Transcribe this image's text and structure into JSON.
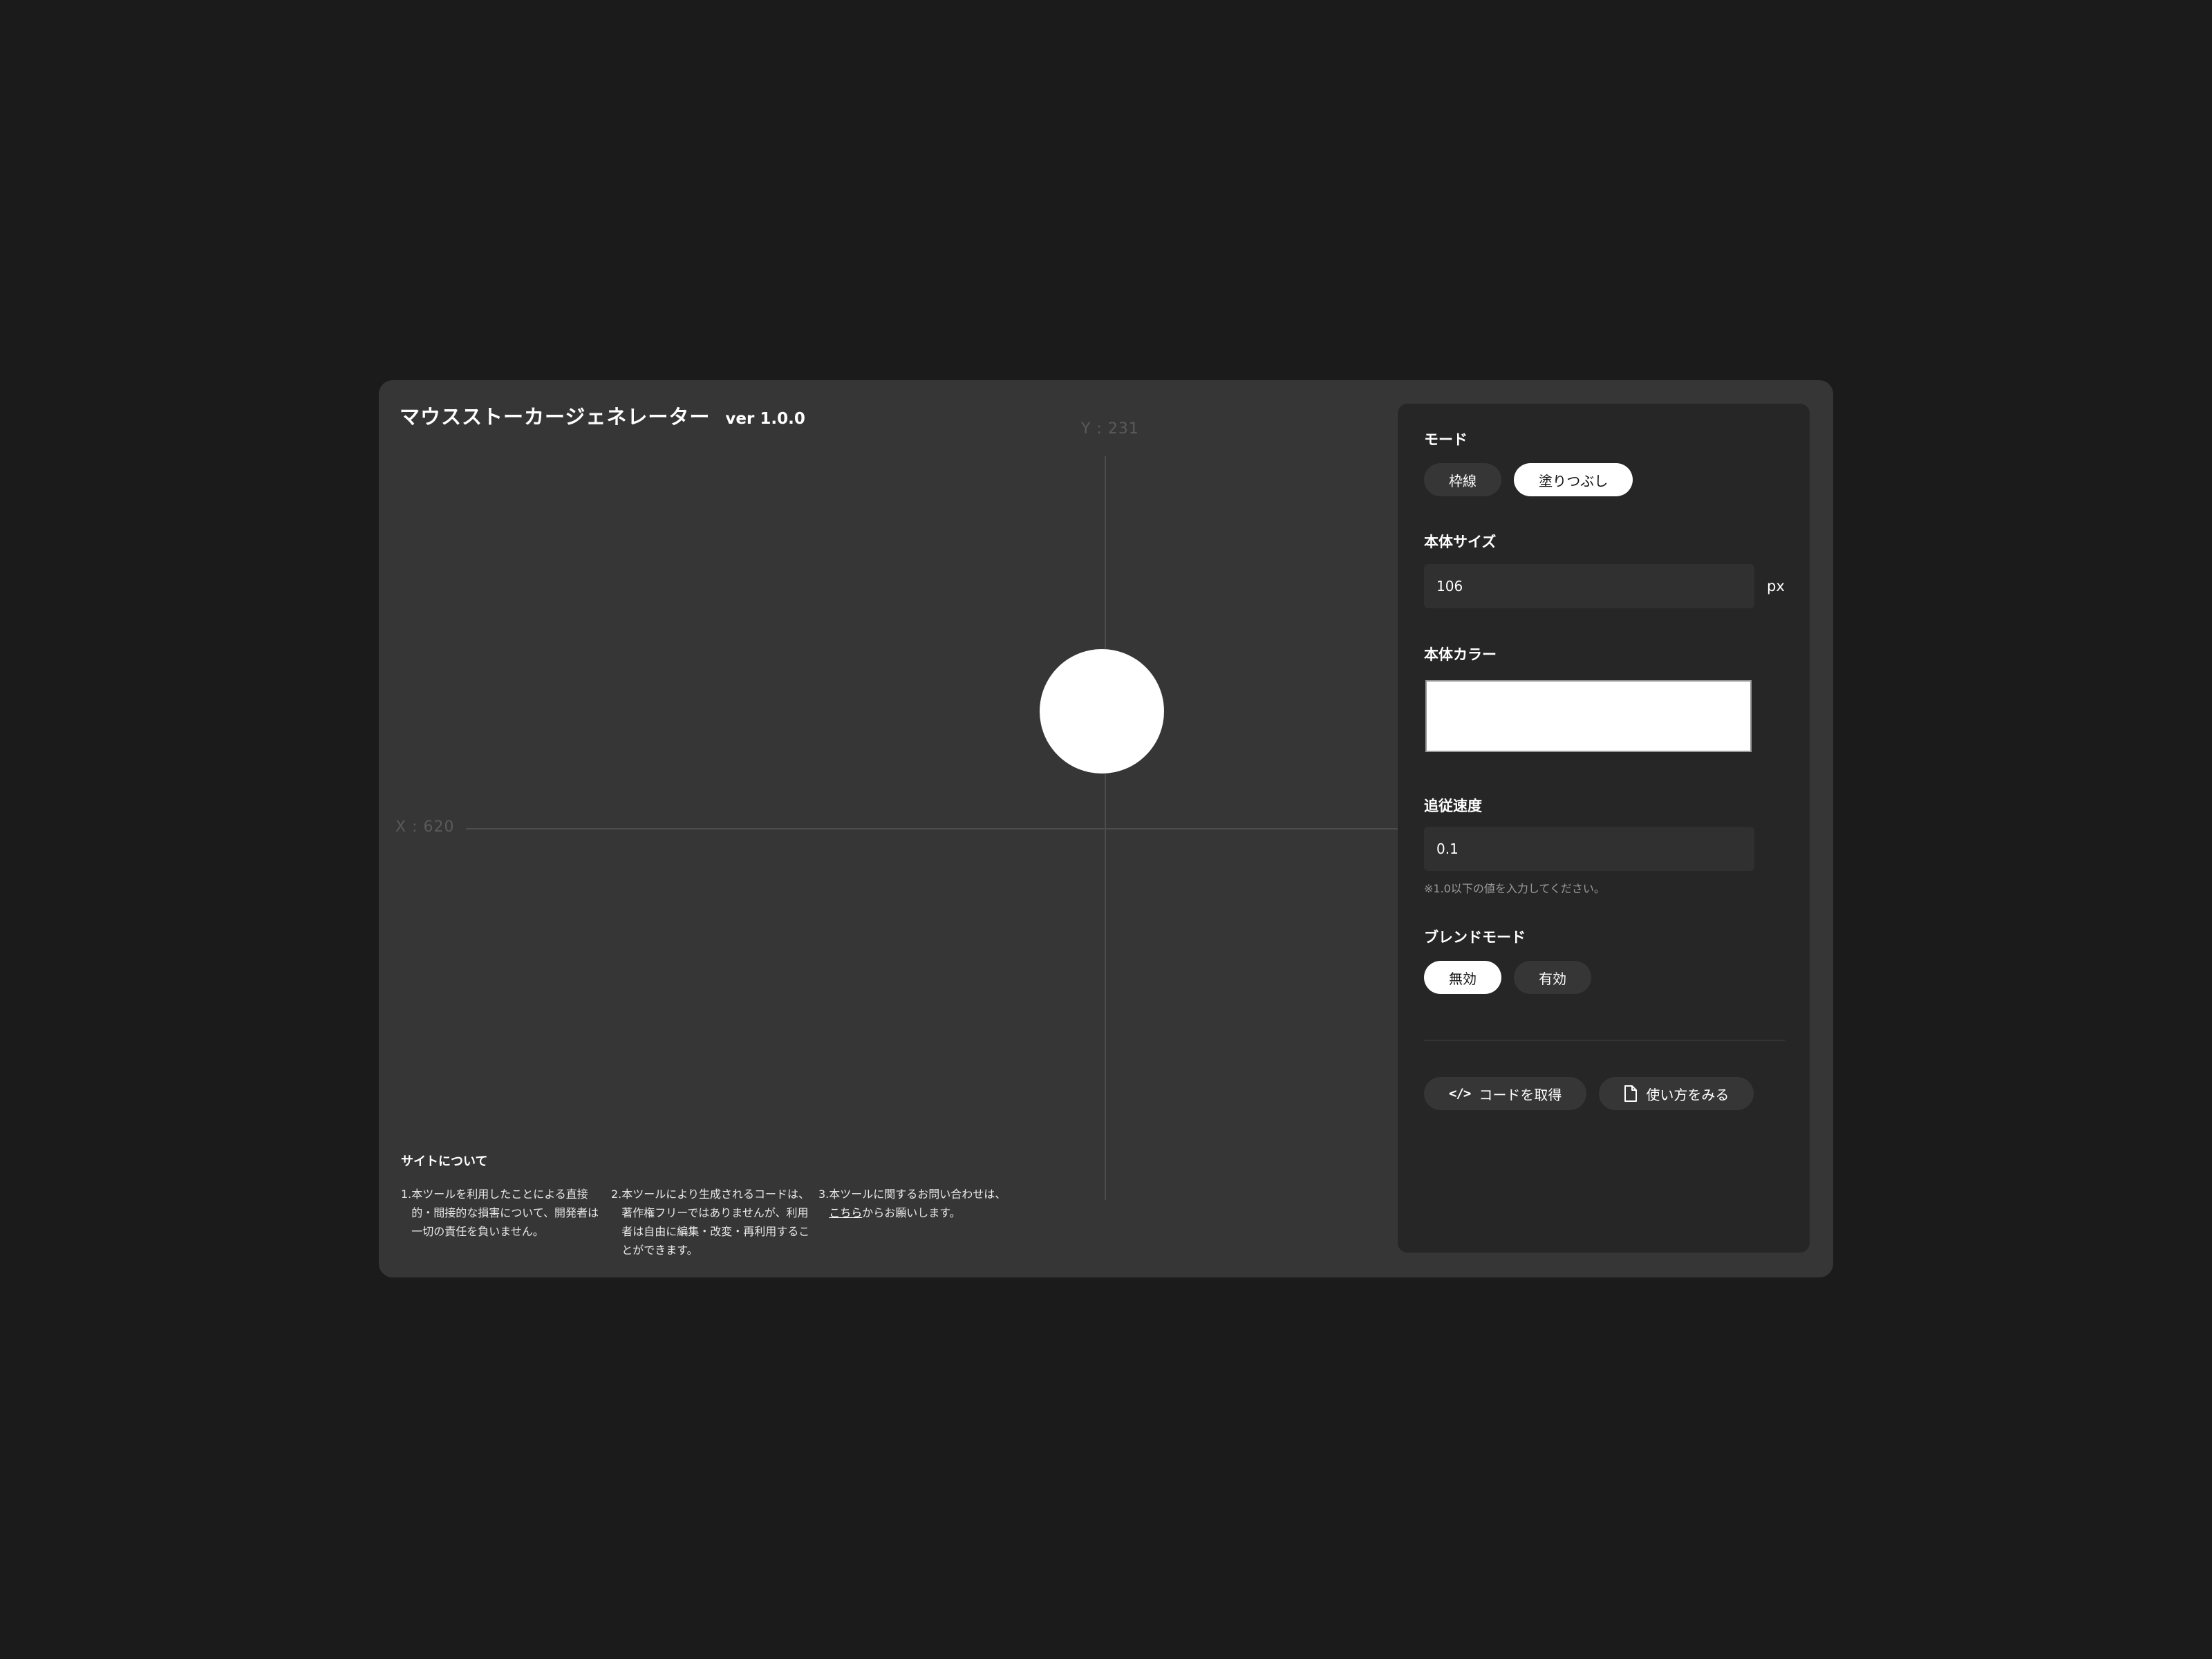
{
  "app": {
    "title": "マウスストーカージェネレーター",
    "version": "ver 1.0.0"
  },
  "canvas": {
    "y_readout": "Y : 231",
    "x_readout": "X : 620",
    "stalker_color": "#ffffff"
  },
  "about": {
    "title": "サイトについて",
    "notes": [
      {
        "num": "1.",
        "text": "本ツールを利用したことによる直接的・間接的な損害について、開発者は一切の責任を負いません。"
      },
      {
        "num": "2.",
        "text": "本ツールにより生成されるコードは、著作権フリーではありませんが、利用者は自由に編集・改変・再利用することができます。"
      },
      {
        "num": "3.",
        "text_before": "本ツールに関するお問い合わせは、",
        "link": "こちら",
        "text_after": "からお願いします。"
      }
    ]
  },
  "panel": {
    "mode": {
      "label": "モード",
      "options": [
        "枠線",
        "塗りつぶし"
      ],
      "selected": "塗りつぶし"
    },
    "size": {
      "label": "本体サイズ",
      "value": "106",
      "unit": "px"
    },
    "color": {
      "label": "本体カラー",
      "value": "#ffffff"
    },
    "speed": {
      "label": "追従速度",
      "value": "0.1",
      "hint": "※1.0以下の値を入力してください。"
    },
    "blend": {
      "label": "ブレンドモード",
      "options": [
        "無効",
        "有効"
      ],
      "selected": "無効"
    },
    "actions": {
      "get_code_icon": "</>",
      "get_code": "コードを取得",
      "how_to_icon": "document-icon",
      "how_to": "使い方をみる"
    }
  },
  "colors": {
    "background": "#1b1b1b",
    "app_surface": "#363636",
    "panel_surface": "#262626",
    "accent": "#ffffff"
  }
}
